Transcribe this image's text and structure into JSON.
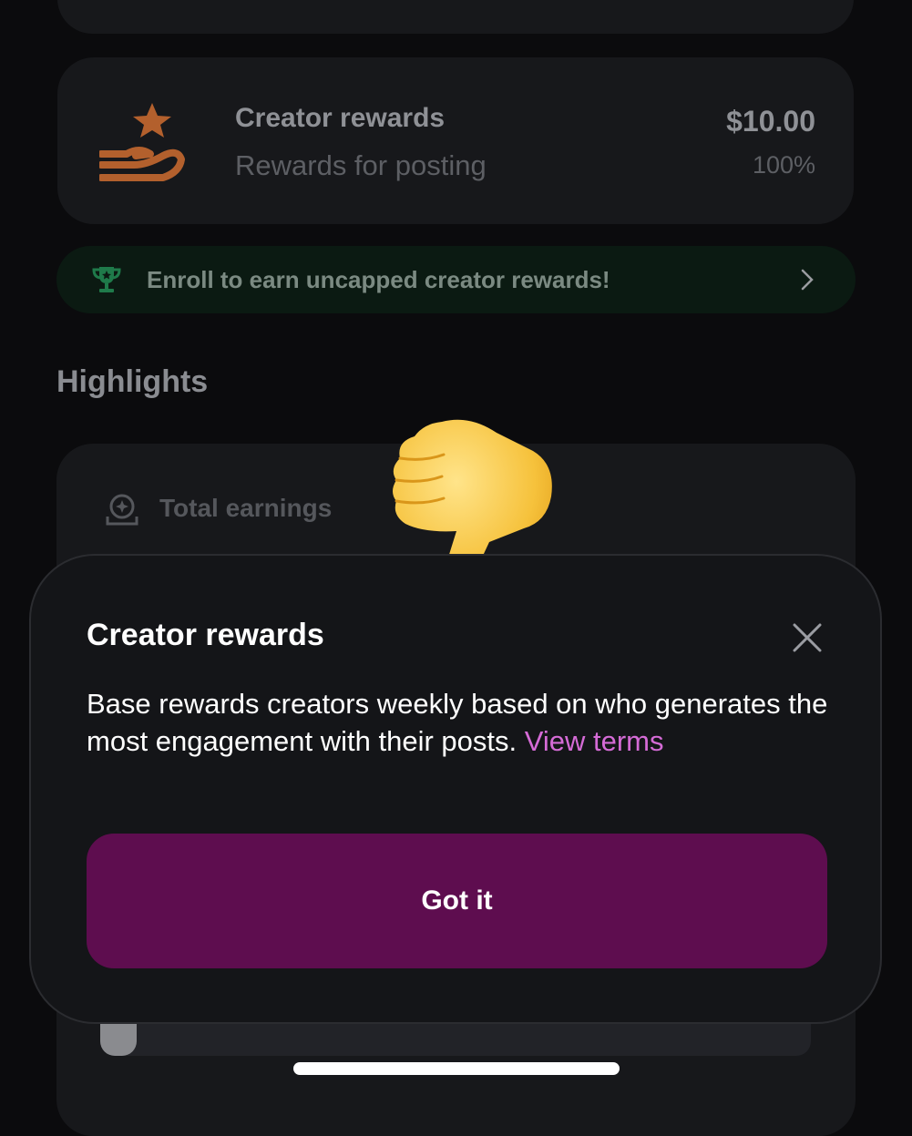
{
  "reward_card": {
    "title": "Creator rewards",
    "subtitle": "Rewards for posting",
    "amount": "$10.00",
    "percent": "100%",
    "icon": "hand-star-icon",
    "icon_color": "#b3602d"
  },
  "enroll_banner": {
    "text": "Enroll to earn uncapped creator rewards!",
    "icon": "trophy-icon",
    "icon_color": "#1f7a4a"
  },
  "highlights": {
    "heading": "Highlights",
    "total_earnings_label": "Total earnings"
  },
  "overlay_emoji": "thumbs-down-emoji",
  "modal": {
    "title": "Creator rewards",
    "body": "Base rewards creators weekly based on who generates the most engagement with their posts. ",
    "link": "View terms",
    "button": "Got it",
    "button_color": "#5e0d4f",
    "link_color": "#d56bd6"
  }
}
